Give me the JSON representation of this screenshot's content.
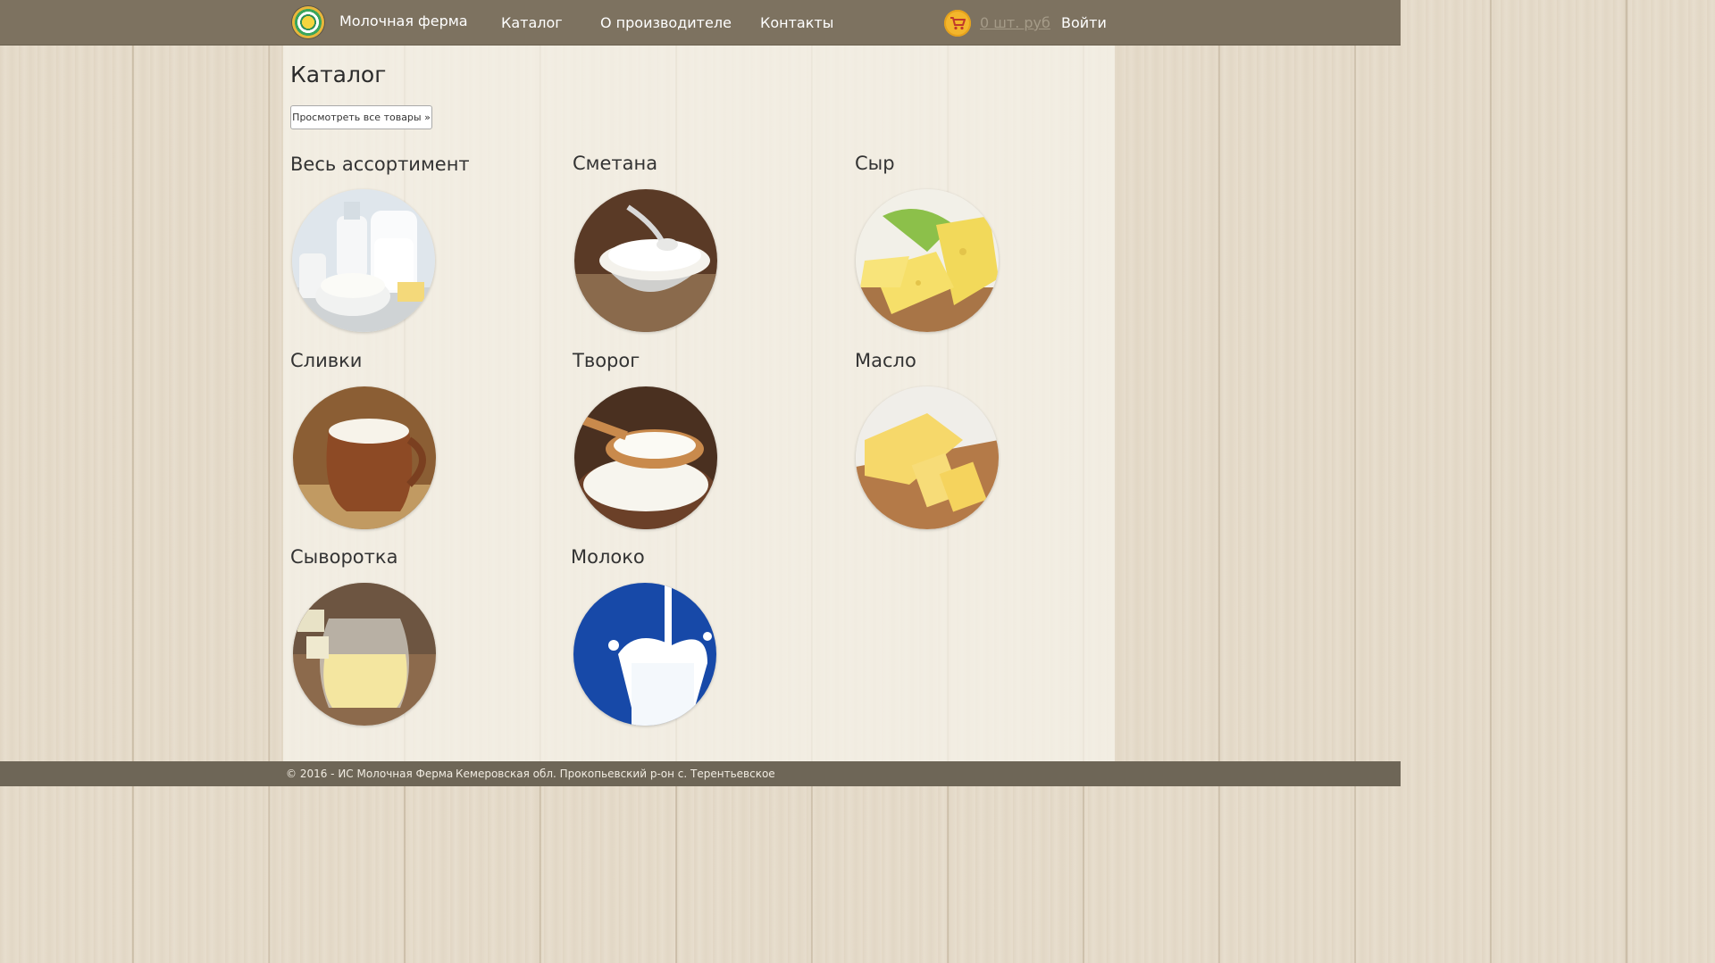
{
  "header": {
    "brand": "Молочная ферма",
    "nav": [
      {
        "label": "Каталог"
      },
      {
        "label": "О производителе"
      },
      {
        "label": "Контакты"
      }
    ],
    "cart_label": "0 шт. руб",
    "login_label": "Войти"
  },
  "main": {
    "title": "Каталог",
    "view_all_label": "Просмотреть все товары »",
    "categories": [
      {
        "title": "Весь ассортимент",
        "icon": "dairy-assortment-image"
      },
      {
        "title": "Сметана",
        "icon": "sour-cream-image"
      },
      {
        "title": "Сыр",
        "icon": "cheese-image"
      },
      {
        "title": "Сливки",
        "icon": "cream-jug-image"
      },
      {
        "title": "Творог",
        "icon": "cottage-cheese-image"
      },
      {
        "title": "Масло",
        "icon": "butter-image"
      },
      {
        "title": "Сыворотка",
        "icon": "whey-jug-image"
      },
      {
        "title": "Молоко",
        "icon": "milk-glass-image"
      }
    ]
  },
  "footer": {
    "copyright": "© 2016 - ИС Молочная Ферма",
    "address": "Кемеровская обл. Прокопьевский р-он с. Терентьевское"
  },
  "colors": {
    "header_bg": "#7d7260",
    "footer_bg": "#6e6657",
    "cart_icon": "#f3b62c",
    "cart_link": "#a59b88",
    "milk_blue": "#1749a8"
  }
}
